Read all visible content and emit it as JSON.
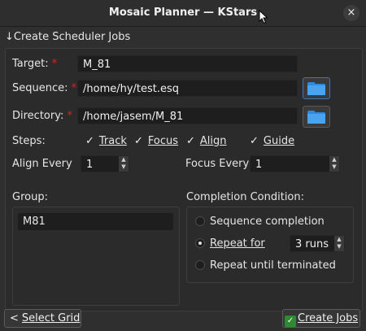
{
  "window": {
    "title": "Mosaic Planner — KStars",
    "close_glyph": "×"
  },
  "section": {
    "title": "↓Create  Scheduler Jobs"
  },
  "form": {
    "target_label": "Target:",
    "target_value": "M_81",
    "sequence_label": "Sequence:",
    "sequence_value": "/home/hy/test.esq",
    "directory_label": "Directory:",
    "directory_value": "/home/jasem/M_81",
    "required_mark": "*"
  },
  "steps": {
    "label": "Steps:",
    "items": [
      {
        "label": "Track",
        "checked": true
      },
      {
        "label": "Focus",
        "checked": true
      },
      {
        "label": "Align",
        "checked": true
      },
      {
        "label": "Guide",
        "checked": true
      }
    ],
    "check_glyph": "✓"
  },
  "align_every": {
    "label": "Align Every",
    "value": "1"
  },
  "focus_every": {
    "label": "Focus Every",
    "value": "1"
  },
  "group": {
    "label": "Group:",
    "items": [
      "M81"
    ]
  },
  "completion": {
    "label": "Completion Condition:",
    "options": [
      {
        "label": "Sequence completion",
        "selected": false
      },
      {
        "label": "Repeat for",
        "selected": true
      },
      {
        "label": "Repeat until terminated",
        "selected": false
      }
    ],
    "runs_value": "3 runs"
  },
  "buttons": {
    "select_grid": "Select Grid",
    "select_grid_glyph": "<",
    "create_jobs": "Create Jobs",
    "create_jobs_glyph": "✓"
  },
  "colors": {
    "accent": "#3d74b5",
    "folder": "#2c8be0",
    "ok": "#2e8b32",
    "required": "#e0201f"
  },
  "icons": [
    "close-icon",
    "folder-icon",
    "check-icon",
    "arrow-left-icon",
    "spin-arrows-icon"
  ]
}
